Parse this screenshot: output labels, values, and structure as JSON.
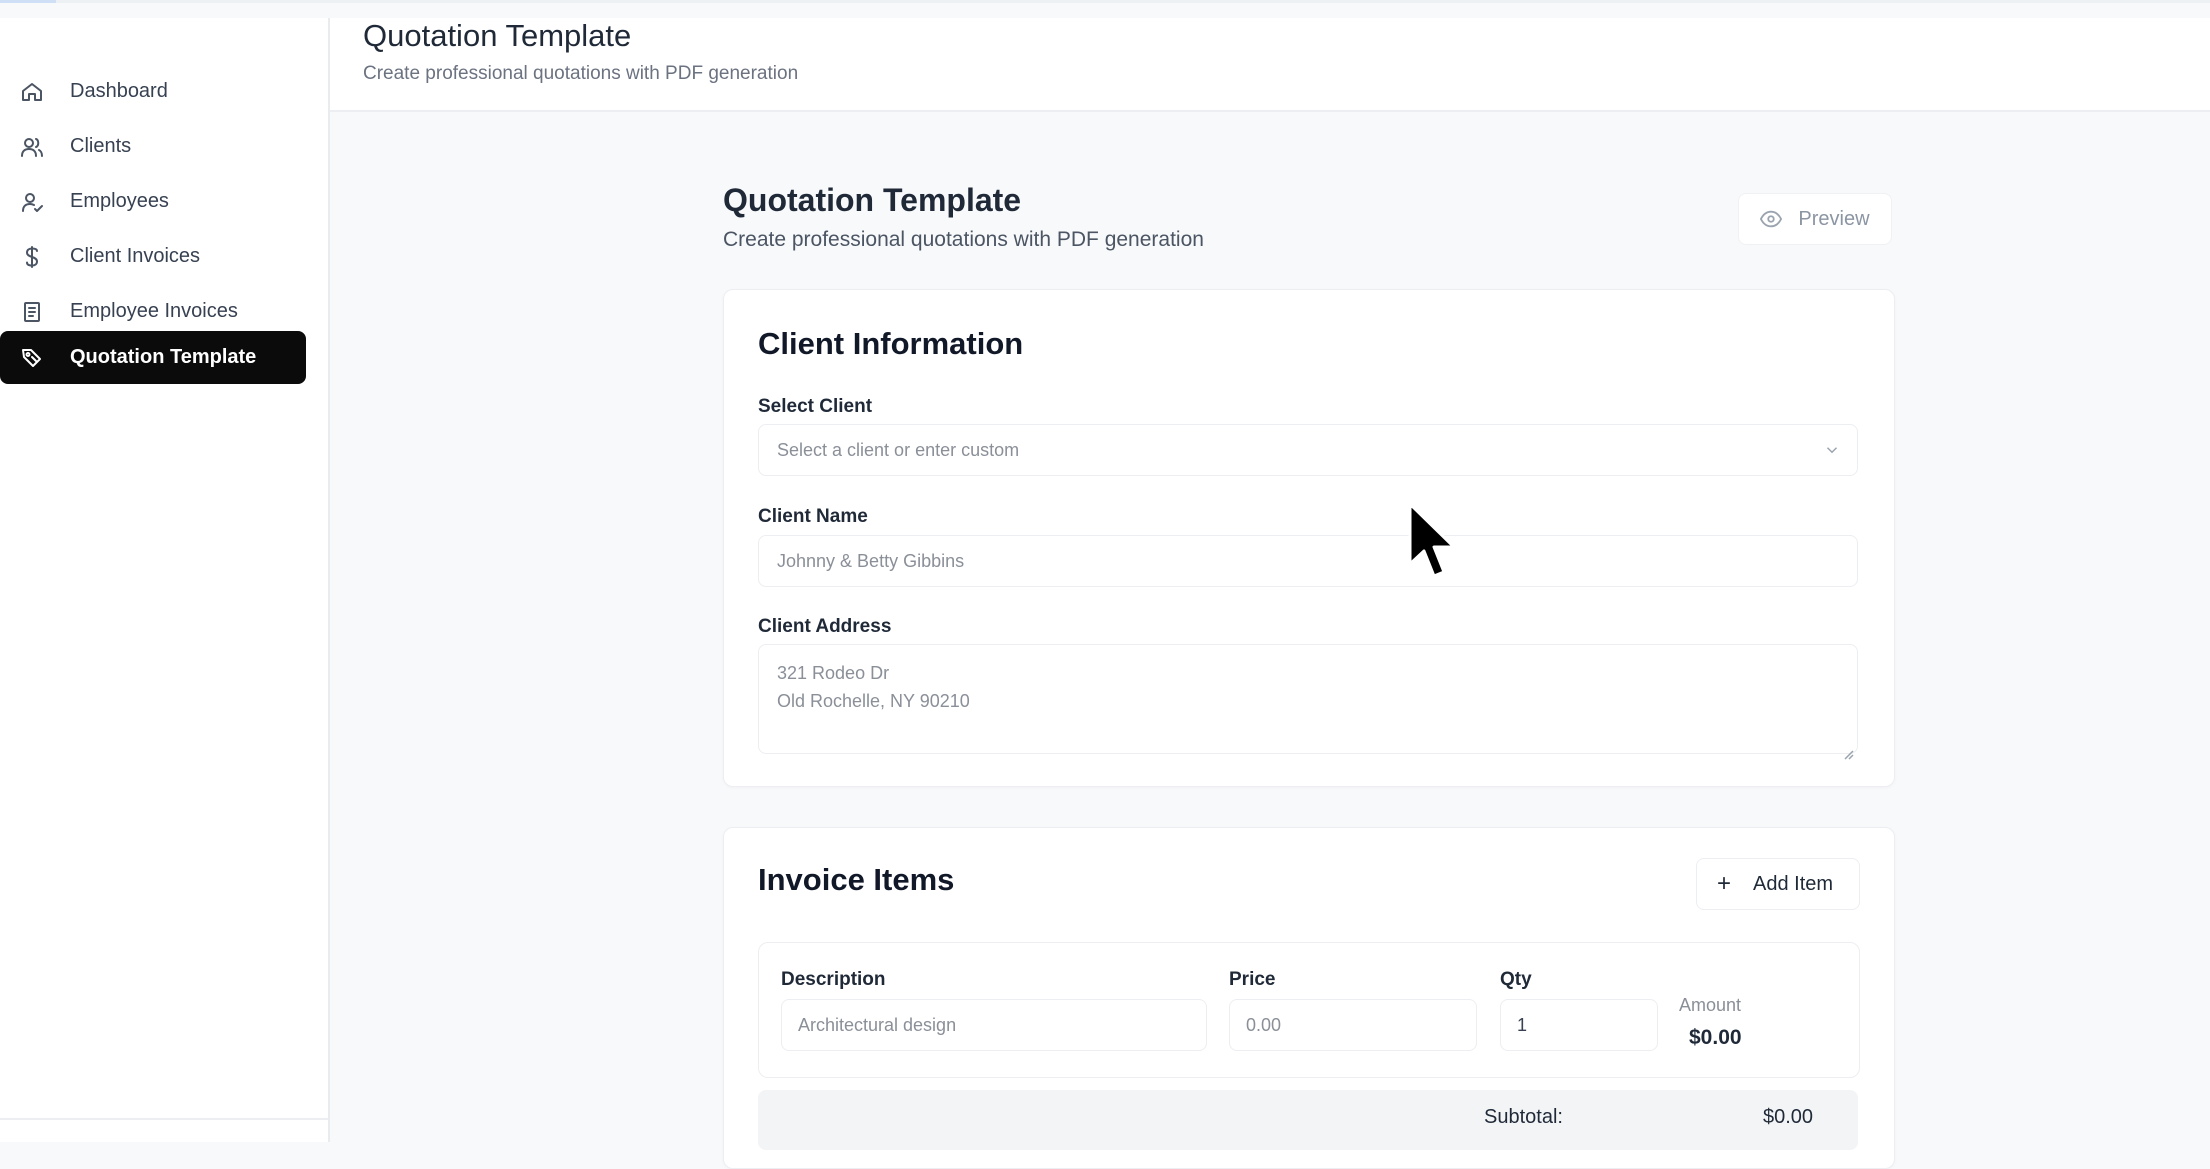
{
  "sidebar": {
    "items": [
      {
        "label": "Dashboard",
        "icon": "home-icon"
      },
      {
        "label": "Clients",
        "icon": "users-icon"
      },
      {
        "label": "Employees",
        "icon": "user-check-icon"
      },
      {
        "label": "Client Invoices",
        "icon": "dollar-icon"
      },
      {
        "label": "Employee Invoices",
        "icon": "receipt-icon"
      },
      {
        "label": "Quotation Template",
        "icon": "tag-icon",
        "active": true
      }
    ]
  },
  "header": {
    "title": "Quotation Template",
    "subtitle": "Create professional quotations with PDF generation"
  },
  "main": {
    "title": "Quotation Template",
    "subtitle": "Create professional quotations with PDF generation",
    "preview_label": "Preview"
  },
  "client_info": {
    "title": "Client Information",
    "select_label": "Select Client",
    "select_placeholder": "Select a client or enter custom",
    "name_label": "Client Name",
    "name_placeholder": "Johnny & Betty Gibbins",
    "address_label": "Client Address",
    "address_line1": "321 Rodeo Dr",
    "address_line2": "Old Rochelle, NY 90210"
  },
  "invoice_items": {
    "title": "Invoice Items",
    "add_label": "Add Item",
    "columns": {
      "description": "Description",
      "price": "Price",
      "qty": "Qty",
      "amount": "Amount"
    },
    "row": {
      "description_placeholder": "Architectural design",
      "price_placeholder": "0.00",
      "qty": "1",
      "amount": "$0.00"
    },
    "subtotal_label": "Subtotal:",
    "subtotal_value": "$0.00"
  }
}
